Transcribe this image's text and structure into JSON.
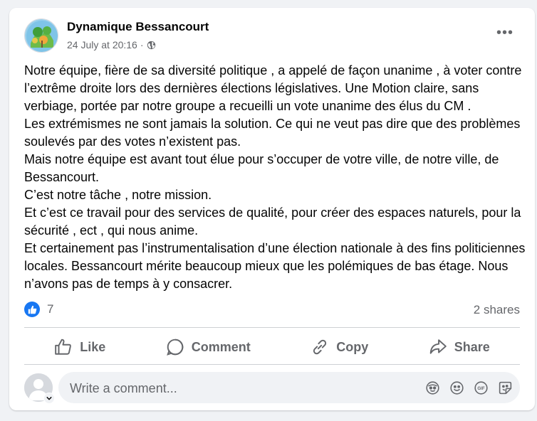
{
  "post": {
    "author": "Dynamique Bessancourt",
    "timestamp": "24 July at 20:16",
    "separator": "·",
    "audience_icon": "globe-icon",
    "more_icon": "•••",
    "text": "Notre équipe, fière de sa diversité politique , a appelé de façon unanime , à voter contre l’extrême droite lors des dernières élections législatives. Une Motion claire, sans verbiage, portée par notre groupe a recueilli un vote unanime des élus du CM  .\nLes extrémismes ne sont jamais la solution. Ce qui ne veut pas dire que des problèmes soulevés par des votes n’existent pas.\nMais notre équipe est avant tout élue pour s’occuper de votre ville, de notre ville, de Bessancourt.\nC’est notre tâche , notre mission.\nEt c’est ce travail pour des services de qualité, pour créer des espaces naturels, pour la sécurité , ect , qui nous anime.\nEt certainement pas l’instrumentalisation d’une élection nationale à des fins politiciennes locales. Bessancourt mérite beaucoup mieux que les polémiques de bas étage. Nous n’avons pas de temps à y consacrer."
  },
  "stats": {
    "reaction_count": "7",
    "shares": "2 shares"
  },
  "actions": {
    "like": "Like",
    "comment": "Comment",
    "copy": "Copy",
    "share": "Share"
  },
  "comment_input": {
    "placeholder": "Write a comment...",
    "icons": [
      "avatar-sticker-icon",
      "emoji-icon",
      "gif-icon",
      "sticker-icon"
    ]
  },
  "colors": {
    "accent": "#1877f2",
    "secondary_text": "#65676b",
    "background": "#f0f2f5"
  }
}
